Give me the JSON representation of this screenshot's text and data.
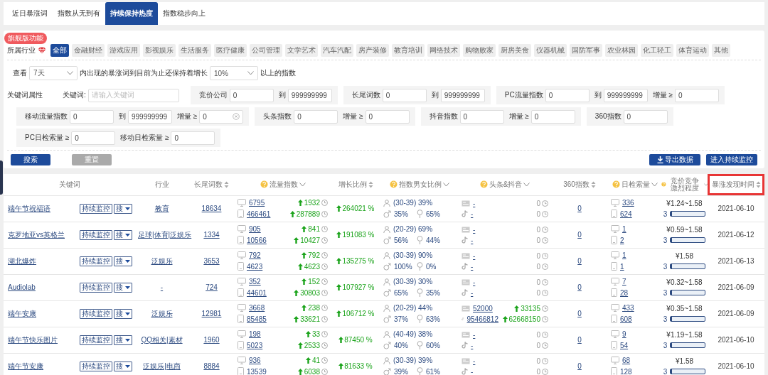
{
  "tabs": [
    {
      "label": "近日暴涨词",
      "selected": false
    },
    {
      "label": "指数从无到有",
      "selected": false
    },
    {
      "label": "持续保持热度",
      "selected": true
    },
    {
      "label": "指数稳步向上",
      "selected": false
    }
  ],
  "industry": {
    "label": "所属行业",
    "badge": "旗舰版功能",
    "options": [
      {
        "label": "全部",
        "selected": true
      },
      {
        "label": "金融财经",
        "selected": false
      },
      {
        "label": "游戏应用",
        "selected": false
      },
      {
        "label": "影视娱乐",
        "selected": false
      },
      {
        "label": "生活服务",
        "selected": false
      },
      {
        "label": "医疗健康",
        "selected": false
      },
      {
        "label": "公司管理",
        "selected": false
      },
      {
        "label": "文学艺术",
        "selected": false
      },
      {
        "label": "汽车汽配",
        "selected": false
      },
      {
        "label": "房产装修",
        "selected": false
      },
      {
        "label": "教育培训",
        "selected": false
      },
      {
        "label": "网络技术",
        "selected": false
      },
      {
        "label": "购物败家",
        "selected": false
      },
      {
        "label": "厨房美食",
        "selected": false
      },
      {
        "label": "仪器机械",
        "selected": false
      },
      {
        "label": "国防军事",
        "selected": false
      },
      {
        "label": "农业林园",
        "selected": false
      },
      {
        "label": "化工轻工",
        "selected": false
      },
      {
        "label": "体育运动",
        "selected": false
      },
      {
        "label": "其他",
        "selected": false
      }
    ]
  },
  "view": {
    "label": "查看",
    "period": "7天",
    "middle": "内出现的暴涨词到目前为止还保持着增长",
    "growth": "10%",
    "suffix": "以上的指数"
  },
  "attributes": {
    "label": "关键词属性",
    "rows": [
      [
        {
          "fields": [
            {
              "label": "竞价公司",
              "value": "0",
              "clearable": false
            },
            {
              "label": "到",
              "value": "999999999",
              "clearable": false
            }
          ]
        },
        {
          "fields": [
            {
              "label": "长尾词数",
              "value": "0",
              "clearable": false
            },
            {
              "label": "到",
              "value": "999999999",
              "clearable": false
            }
          ]
        },
        {
          "fields": [
            {
              "label": "PC流量指数",
              "value": "0",
              "clearable": false
            },
            {
              "label": "到",
              "value": "999999999",
              "clearable": false
            },
            {
              "label": "增量 ≥",
              "value": "0",
              "clearable": false
            }
          ]
        }
      ],
      [
        {
          "fields": [
            {
              "label": "移动流量指数",
              "value": "0",
              "clearable": false
            },
            {
              "label": "到",
              "value": "999999999",
              "clearable": false
            },
            {
              "label": "增量 ≥",
              "value": "0",
              "clearable": true
            }
          ]
        },
        {
          "fields": [
            {
              "label": "头条指数",
              "value": "0",
              "clearable": false
            },
            {
              "label": "增量 ≥",
              "value": "0",
              "clearable": false
            }
          ]
        },
        {
          "fields": [
            {
              "label": "抖音指数",
              "value": "0",
              "clearable": false
            },
            {
              "label": "增量 ≥",
              "value": "0",
              "clearable": false
            }
          ]
        },
        {
          "fields": [
            {
              "label": "360指数",
              "value": "0",
              "clearable": false
            }
          ]
        }
      ],
      [
        {
          "fields": [
            {
              "label": "PC日检索量 ≥",
              "value": "0",
              "clearable": false
            },
            {
              "label": "移动日检索量 ≥",
              "value": "0",
              "clearable": false
            }
          ]
        }
      ]
    ],
    "keyword": {
      "label": "关键词:",
      "placeholder": "请输入关键词"
    }
  },
  "actions": {
    "search": "搜索",
    "reset": "重置",
    "export": "导出数据",
    "monitor": "进入持续监控"
  },
  "table": {
    "columns": [
      {
        "label": "关键词",
        "kind": "plain"
      },
      {
        "label": "行业",
        "kind": "plain"
      },
      {
        "label": "长尾词数",
        "kind": "sortable"
      },
      {
        "label": "流量指数",
        "help": true,
        "kind": "menu"
      },
      {
        "label": "增长比例",
        "kind": "sortable"
      },
      {
        "label": "指数男女比例",
        "help": true,
        "kind": "menu"
      },
      {
        "label": "头条&抖音",
        "help": true,
        "kind": "menu"
      },
      {
        "label": "360指数",
        "kind": "sortable"
      },
      {
        "label": "日检索量",
        "help": true,
        "kind": "menu"
      },
      {
        "label": "竞价竞争激烈程度",
        "help": true,
        "kind": "menu"
      },
      {
        "label": "暴涨发现时间",
        "kind": "sortable",
        "highlighted": true
      }
    ],
    "rows": [
      {
        "keyword": "端午节祝福语",
        "monitor": "持续监控",
        "search": "搜",
        "industry": "教育",
        "longtail": "18634",
        "pc": {
          "value": "6795",
          "delta": "1932",
          "rising": true
        },
        "mobile": {
          "value": "466461",
          "delta": "287889",
          "rising": true
        },
        "growth": "264021 %",
        "age": "(30-39) 39%",
        "male": "35%",
        "female": "65%",
        "toutiao": {
          "value": "-",
          "delta": "0",
          "rising": false
        },
        "douyin": {
          "value": "-",
          "delta": "0",
          "rising": false
        },
        "i360": "0",
        "daily_pc": "336",
        "daily_mobile": "624",
        "price": "¥1.24~1.58",
        "grade": "3",
        "level": 0.03,
        "date": "2021-06-10"
      },
      {
        "keyword": "克罗地亚vs英格兰",
        "monitor": "持续监控",
        "search": "搜",
        "industry": "足球|体育|泛娱乐",
        "longtail": "1334",
        "pc": {
          "value": "905",
          "delta": "841",
          "rising": true
        },
        "mobile": {
          "value": "10566",
          "delta": "10427",
          "rising": true
        },
        "growth": "191083 %",
        "age": "(20-29) 69%",
        "male": "56%",
        "female": "44%",
        "toutiao": {
          "value": "-",
          "delta": "0",
          "rising": false
        },
        "douyin": {
          "value": "-",
          "delta": "0",
          "rising": false
        },
        "i360": "0",
        "daily_pc": "1",
        "daily_mobile": "2",
        "price": "¥0.59~1.58",
        "grade": "3",
        "level": 0.03,
        "date": "2021-06-12"
      },
      {
        "keyword": "湖北爆炸",
        "monitor": "持续监控",
        "search": "搜",
        "industry": "泛娱乐",
        "longtail": "3653",
        "pc": {
          "value": "792",
          "delta": "792",
          "rising": true
        },
        "mobile": {
          "value": "4623",
          "delta": "4623",
          "rising": true
        },
        "growth": "135275 %",
        "age": "(30-39) 90%",
        "male": "100%",
        "female": "0%",
        "toutiao": {
          "value": "-",
          "delta": "0",
          "rising": false
        },
        "douyin": {
          "value": "-",
          "delta": "0",
          "rising": false
        },
        "i360": "0",
        "daily_pc": "1",
        "daily_mobile": "1",
        "price": "¥1.58",
        "grade": "3",
        "level": 0.03,
        "date": "2021-06-13"
      },
      {
        "keyword": "Audiolab",
        "monitor": "持续监控",
        "search": "搜",
        "industry": "-",
        "longtail": "724",
        "pc": {
          "value": "352",
          "delta": "152",
          "rising": true
        },
        "mobile": {
          "value": "44601",
          "delta": "30803",
          "rising": true
        },
        "growth": "107927 %",
        "age": "(30-39) 30%",
        "male": "65%",
        "female": "35%",
        "toutiao": {
          "value": "-",
          "delta": "0",
          "rising": false
        },
        "douyin": {
          "value": "-",
          "delta": "0",
          "rising": false
        },
        "i360": "0",
        "daily_pc": "7",
        "daily_mobile": "28",
        "price": "¥0.32~1.58",
        "grade": "3",
        "level": 0.03,
        "date": "2021-06-09"
      },
      {
        "keyword": "端午安康",
        "monitor": "持续监控",
        "search": "搜",
        "industry": "泛娱乐",
        "longtail": "12981",
        "pc": {
          "value": "3668",
          "delta": "238",
          "rising": true
        },
        "mobile": {
          "value": "85485",
          "delta": "33621",
          "rising": true
        },
        "growth": "106712 %",
        "age": "(20-29) 44%",
        "male": "37%",
        "female": "63%",
        "toutiao": {
          "value": "52000",
          "delta": "33135",
          "rising": true
        },
        "douyin": {
          "value": "95466812",
          "delta": "62668150",
          "rising": true
        },
        "i360": "0",
        "daily_pc": "433",
        "daily_mobile": "608",
        "price": "¥0.35~1.58",
        "grade": "3",
        "level": 0.03,
        "date": "2021-06-09"
      },
      {
        "keyword": "端午节快乐图片",
        "monitor": "持续监控",
        "search": "搜",
        "industry": "QQ相关|素材",
        "longtail": "1960",
        "pc": {
          "value": "198",
          "delta": "33",
          "rising": true
        },
        "mobile": {
          "value": "5023",
          "delta": "2533",
          "rising": true
        },
        "growth": "87450 %",
        "age": "(40-49) 38%",
        "male": "40%",
        "female": "60%",
        "toutiao": {
          "value": "-",
          "delta": "0",
          "rising": false
        },
        "douyin": {
          "value": "-",
          "delta": "0",
          "rising": false
        },
        "i360": "0",
        "daily_pc": "9",
        "daily_mobile": "54",
        "price": "¥1.19~1.58",
        "grade": "3",
        "level": 0.03,
        "date": "2021-06-10"
      },
      {
        "keyword": "端午节安康",
        "monitor": "持续监控",
        "search": "搜",
        "industry": "泛娱乐|电商",
        "longtail": "8884",
        "pc": {
          "value": "936",
          "delta": "41",
          "rising": true
        },
        "mobile": {
          "value": "13539",
          "delta": "6038",
          "rising": true
        },
        "growth": "81633 %",
        "age": "(30-39) 39%",
        "male": "39%",
        "female": "61%",
        "toutiao": {
          "value": "-",
          "delta": "0",
          "rising": false
        },
        "douyin": {
          "value": "-",
          "delta": "0",
          "rising": false
        },
        "i360": "0",
        "daily_pc": "68",
        "daily_mobile": "128",
        "price": "¥1.58",
        "grade": "3",
        "level": 0.03,
        "date": "2021-06-10"
      }
    ]
  }
}
